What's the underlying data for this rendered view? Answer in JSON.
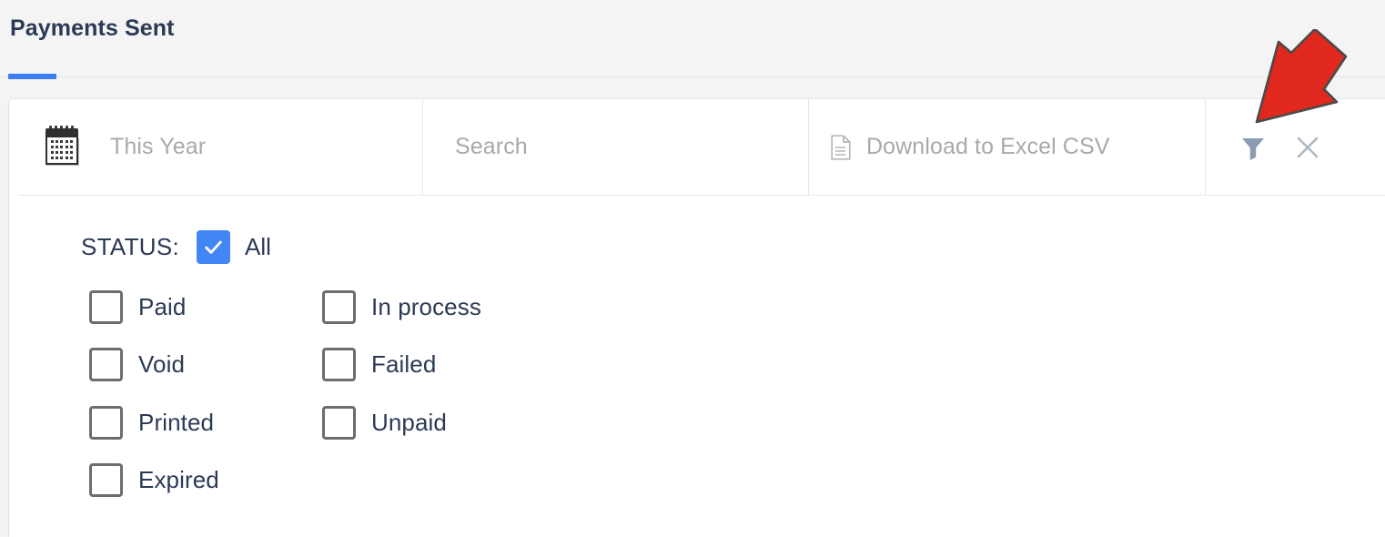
{
  "header": {
    "title": "Payments Sent",
    "accent_color": "#3d7df2"
  },
  "toolbar": {
    "date_filter": {
      "icon": "calendar-icon",
      "value": "This Year"
    },
    "search": {
      "icon": "search-field",
      "placeholder": "Search",
      "value": ""
    },
    "download": {
      "icon": "document-icon",
      "label": "Download to Excel CSV"
    },
    "actions": {
      "filter_icon": "filter-icon",
      "close_icon": "close-icon"
    }
  },
  "filter_panel": {
    "status_label": "STATUS:",
    "all": {
      "label": "All",
      "checked": true
    },
    "options": [
      {
        "label": "Paid",
        "checked": false,
        "col": 0,
        "row": 0
      },
      {
        "label": "In process",
        "checked": false,
        "col": 1,
        "row": 0
      },
      {
        "label": "Void",
        "checked": false,
        "col": 0,
        "row": 1
      },
      {
        "label": "Failed",
        "checked": false,
        "col": 1,
        "row": 1
      },
      {
        "label": "Printed",
        "checked": false,
        "col": 0,
        "row": 2
      },
      {
        "label": "Unpaid",
        "checked": false,
        "col": 1,
        "row": 2
      },
      {
        "label": "Expired",
        "checked": false,
        "col": 0,
        "row": 3
      }
    ]
  },
  "annotation": {
    "arrow": "red-arrow-pointing-to-filter-icon",
    "color": "#e0281e"
  }
}
